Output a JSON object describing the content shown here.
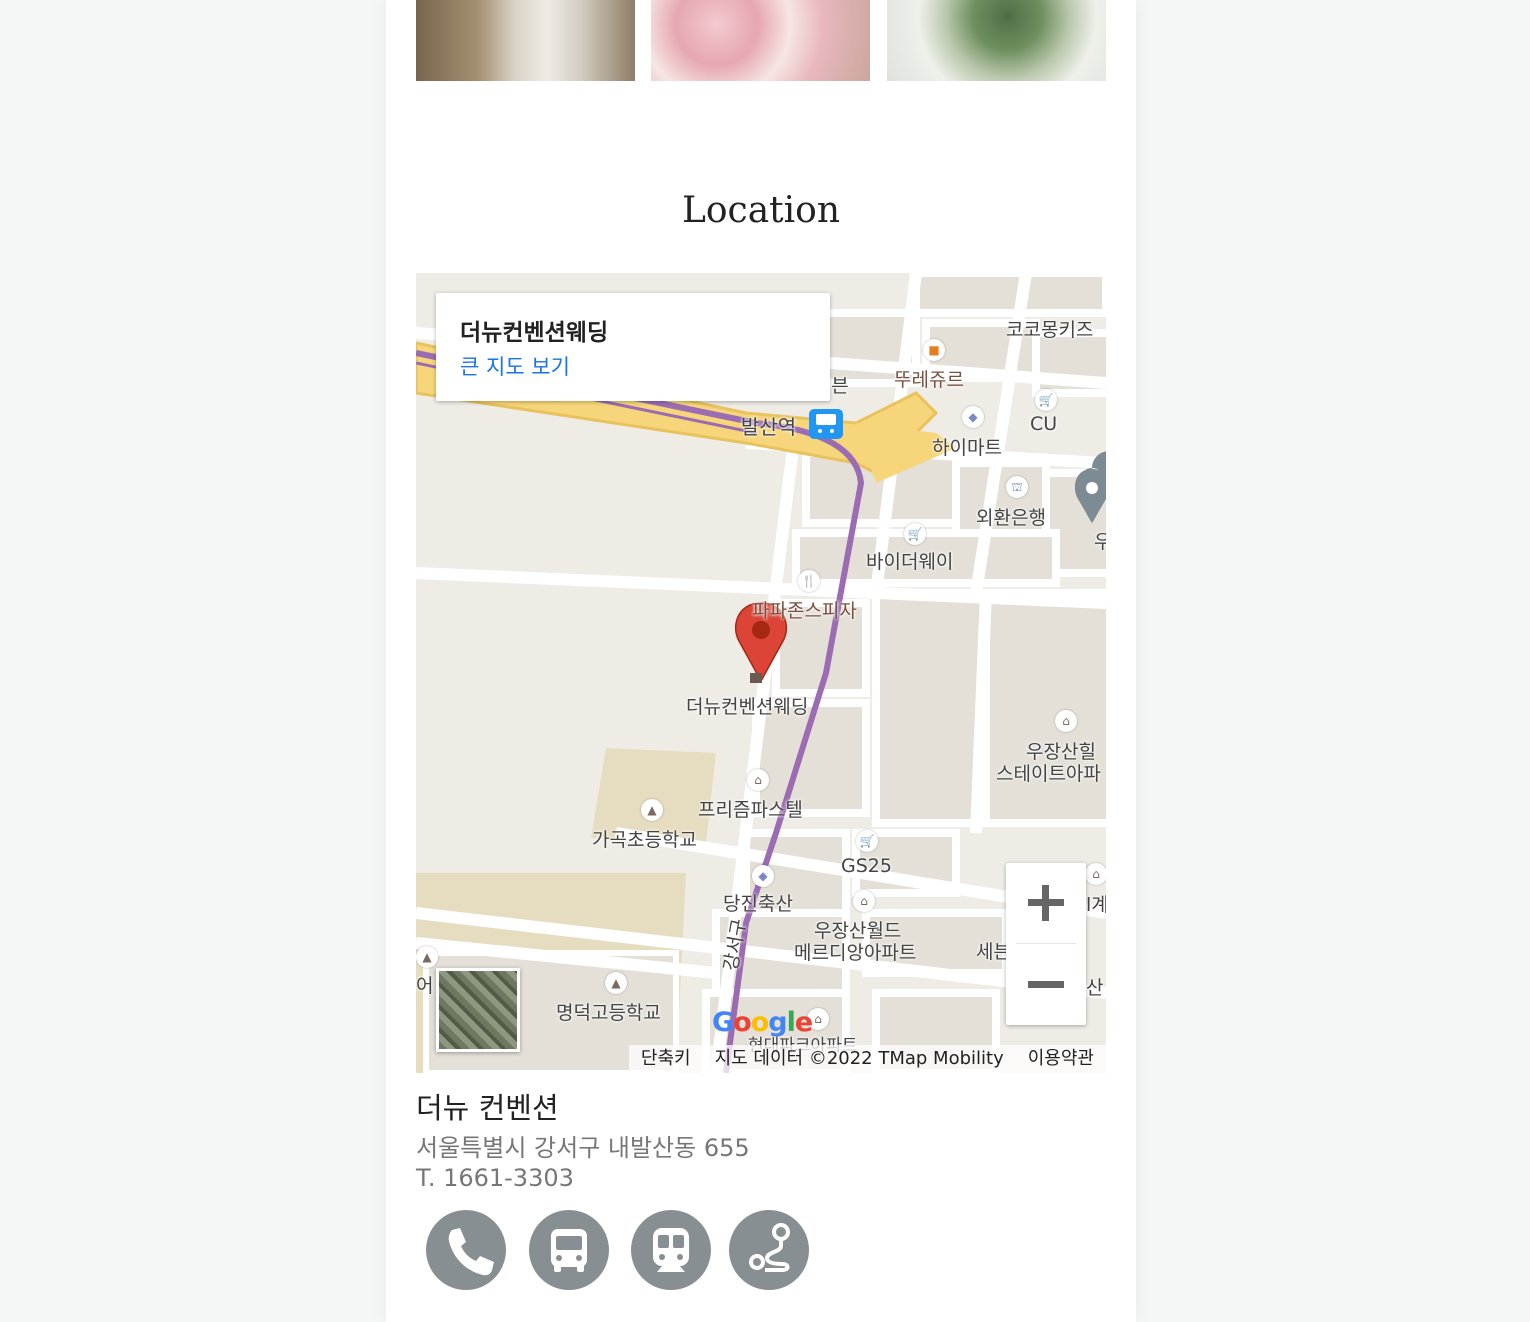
{
  "section_title": "Location",
  "map": {
    "info_card": {
      "place_name": "더뉴컨벤션웨딩",
      "view_larger": "큰 지도 보기"
    },
    "labels": {
      "cocomong": "코코몽키즈",
      "ibn": "l븐",
      "tourlesjours": "뚜레쥬르",
      "balsan": "발산역",
      "cu": "CU",
      "himart": "하이마트",
      "exchange": "외환은행",
      "u": "우",
      "buyerway": "바이더웨이",
      "papa": "파파존스피자",
      "marker": "더뉴컨벤션웨딩",
      "ujang1": "우장산힐",
      "ujang2": "스테이트아파",
      "prism": "프리즘파스텔",
      "gagok": "가곡초등학교",
      "gs25": "GS25",
      "dangjin": "당진축산",
      "ujangworld1": "우장산월드",
      "ujangworld2": "메르디앙아파트",
      "sebeon": "세븐",
      "gye": "l계",
      "san": "산",
      "eo": "어",
      "myeongdeok": "명덕고등학교",
      "gangseo": "강서구",
      "hyundai": "현대파크아파트"
    },
    "google_logo": "Google",
    "attribution": {
      "shortcuts": "단축키",
      "data": "지도 데이터 ©2022 TMap Mobility",
      "terms": "이용약관"
    },
    "zoom_in_icon": "plus-icon",
    "zoom_out_icon": "minus-icon"
  },
  "venue": {
    "name": "더뉴 컨벤션",
    "address": "서울특별시 강서구 내발산동 655",
    "phone": "T. 1661-3303"
  },
  "actions": [
    "phone-icon",
    "bus-icon",
    "subway-icon",
    "route-icon"
  ],
  "colors": {
    "action_bg": "#888f93",
    "link": "#1a73e8",
    "marker": "#db4437"
  }
}
